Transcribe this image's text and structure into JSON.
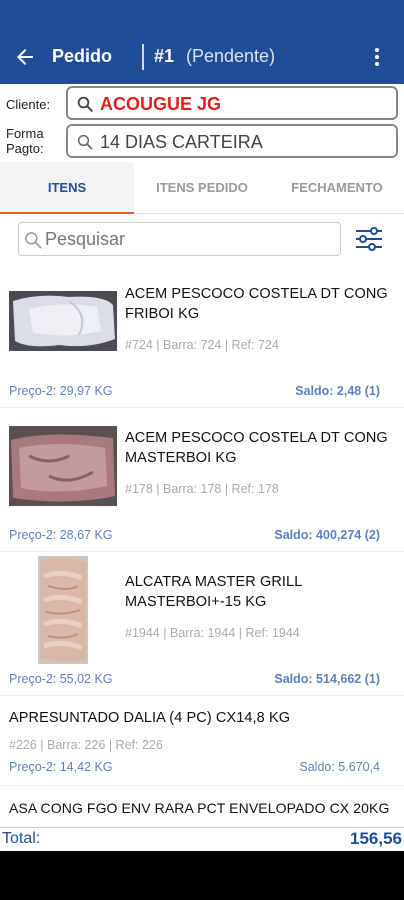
{
  "header": {
    "title": "Pedido",
    "order_number": "#1",
    "status": "(Pendente)"
  },
  "cliente": {
    "label": "Cliente:",
    "value": "ACOUGUE JG"
  },
  "forma_pagto": {
    "label_line1": "Forma",
    "label_line2": "Pagto:",
    "value": "14 DIAS CARTEIRA"
  },
  "tabs": [
    {
      "label": "ITENS",
      "active": true
    },
    {
      "label": "ITENS PEDIDO",
      "active": false
    },
    {
      "label": "FECHAMENTO",
      "active": false
    }
  ],
  "search": {
    "placeholder": "Pesquisar"
  },
  "items": [
    {
      "name_line1": "ACEM PESCOCO COSTELA DT CONG",
      "name_line2": "FRIBOI KG",
      "meta": "#724 | Barra: 724 | Ref: 724",
      "price": "Preço-2: 29,97  KG",
      "saldo": "Saldo: 2,48   (1)"
    },
    {
      "name_line1": "ACEM PESCOCO COSTELA DT CONG",
      "name_line2": "MASTERBOI KG",
      "meta": "#178 | Barra: 178 | Ref: 178",
      "price": "Preço-2: 28,67  KG",
      "saldo": "Saldo: 400,274   (2)"
    },
    {
      "name_line1": "ALCATRA MASTER GRILL",
      "name_line2": "MASTERBOI+-15 KG",
      "meta": "#1944 | Barra: 1944 | Ref: 1944",
      "price": "Preço-2: 55,02  KG",
      "saldo": "Saldo: 514,662   (1)"
    },
    {
      "name_line1": "APRESUNTADO DALIA (4 PC) CX14,8 KG",
      "meta": "#226 | Barra: 226 | Ref: 226",
      "price": "Preço-2: 14,42  KG",
      "saldo": "Saldo: 5.670,4"
    },
    {
      "name_line1": "ASA CONG FGO ENV RARA PCT ENVELOPADO CX 20KG"
    }
  ],
  "total": {
    "label": "Total:",
    "value": "156,56"
  },
  "colors": {
    "primary": "#1f4e96",
    "accent": "#e05a3a",
    "client_red": "#e02020",
    "link_blue": "#5f7fc4"
  }
}
